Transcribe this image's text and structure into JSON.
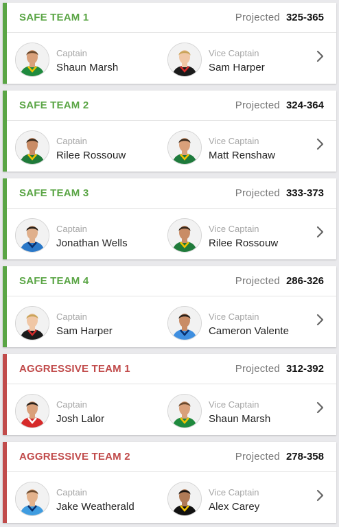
{
  "projected_label": "Projected",
  "teams": [
    {
      "name": "SAFE TEAM 1",
      "kind": "safe",
      "projected": "325-365",
      "captain": {
        "role": "Captain",
        "name": "Shaun Marsh",
        "kit": "#1f8a3e",
        "trim": "#f2c200",
        "skin": "#d9a07a",
        "hair": "#6b4a2e"
      },
      "vice": {
        "role": "Vice Captain",
        "name": "Sam Harper",
        "kit": "#1b1b1b",
        "trim": "#d62a2a",
        "skin": "#f0c7a6",
        "hair": "#c9a45a"
      }
    },
    {
      "name": "SAFE TEAM 2",
      "kind": "safe",
      "projected": "324-364",
      "captain": {
        "role": "Captain",
        "name": "Rilee Rossouw",
        "kit": "#1f7a3a",
        "trim": "#f2c200",
        "skin": "#c98c66",
        "hair": "#3a2a1c"
      },
      "vice": {
        "role": "Vice Captain",
        "name": "Matt Renshaw",
        "kit": "#1e7a3c",
        "trim": "#f2c200",
        "skin": "#d9a07a",
        "hair": "#3a2a1c"
      }
    },
    {
      "name": "SAFE TEAM 3",
      "kind": "safe",
      "projected": "333-373",
      "captain": {
        "role": "Captain",
        "name": "Jonathan Wells",
        "kit": "#2a78c8",
        "trim": "#0a2f6b",
        "skin": "#e0b08c",
        "hair": "#2b211a"
      },
      "vice": {
        "role": "Vice Captain",
        "name": "Rilee Rossouw",
        "kit": "#1f7a3a",
        "trim": "#f2c200",
        "skin": "#c98c66",
        "hair": "#3a2a1c"
      }
    },
    {
      "name": "SAFE TEAM 4",
      "kind": "safe",
      "projected": "286-326",
      "captain": {
        "role": "Captain",
        "name": "Sam Harper",
        "kit": "#1b1b1b",
        "trim": "#d62a2a",
        "skin": "#f0c7a6",
        "hair": "#c9a45a"
      },
      "vice": {
        "role": "Vice Captain",
        "name": "Cameron Valente",
        "kit": "#3f8fe0",
        "trim": "#0a2f6b",
        "skin": "#c98c66",
        "hair": "#2b211a"
      }
    },
    {
      "name": "AGGRESSIVE TEAM 1",
      "kind": "aggr",
      "projected": "312-392",
      "captain": {
        "role": "Captain",
        "name": "Josh Lalor",
        "kit": "#d62a2a",
        "trim": "#ffffff",
        "skin": "#d9a07a",
        "hair": "#2b211a"
      },
      "vice": {
        "role": "Vice Captain",
        "name": "Shaun Marsh",
        "kit": "#1f8a3e",
        "trim": "#f2c200",
        "skin": "#d9a07a",
        "hair": "#6b4a2e"
      }
    },
    {
      "name": "AGGRESSIVE TEAM 2",
      "kind": "aggr",
      "projected": "278-358",
      "captain": {
        "role": "Captain",
        "name": "Jake Weatherald",
        "kit": "#3f9ce0",
        "trim": "#0a2f6b",
        "skin": "#e3b28c",
        "hair": "#6b4a2e"
      },
      "vice": {
        "role": "Vice Captain",
        "name": "Alex Carey",
        "kit": "#111111",
        "trim": "#f2c200",
        "skin": "#b07a56",
        "hair": "#1a1410"
      }
    }
  ],
  "colors": {
    "safe": "#5aa545",
    "aggressive": "#c14b4b"
  },
  "icons": {
    "avatar": "player-avatar-icon",
    "chevron": "chevron-right-icon"
  }
}
